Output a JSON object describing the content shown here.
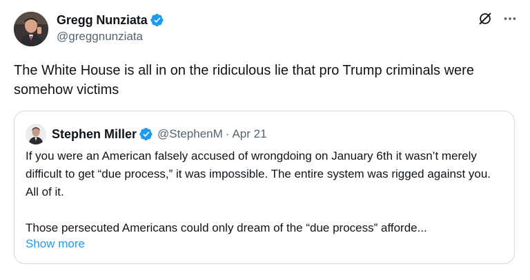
{
  "author": {
    "name": "Gregg Nunziata",
    "handle": "@greggnunziata"
  },
  "tweet": {
    "text": "The White House is all in on the ridiculous lie that pro Trump criminals were somehow victims"
  },
  "quoted": {
    "name": "Stephen Miller",
    "handle": "@StephenM",
    "separator": "·",
    "date": "Apr 21",
    "paragraph1": "If you were an American falsely accused of wrongdoing on January 6th it wasn’t merely difficult to get “due process,” it was impossible. The entire system was rigged against you. All of it.",
    "paragraph2": "Those persecuted Americans could only dream of the “due process” afforde...",
    "show_more": "Show more"
  },
  "icons": {
    "verified": "verified-badge-icon",
    "grok": "grok-icon",
    "more": "more-icon"
  },
  "colors": {
    "accent": "#1d9bf0",
    "secondary_text": "#536471",
    "border": "#cfd9de"
  }
}
